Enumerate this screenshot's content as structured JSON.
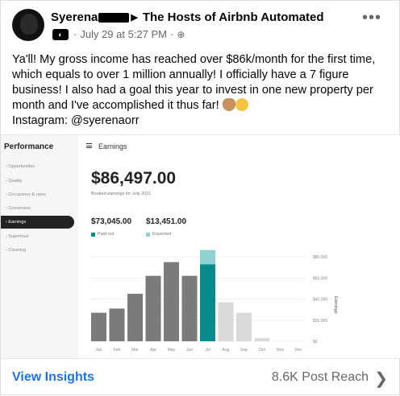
{
  "header": {
    "author_name": "Syerena",
    "group_name": "The Hosts of Airbnb Automated",
    "date": "July 29 at 5:27 PM",
    "separator": "·",
    "privacy_icon": "globe-icon",
    "more_icon": "more-options-icon"
  },
  "post": {
    "text": "Ya'll! My gross income has reached over $86k/month for the first time, which equals to over 1 million annually! I officially have a 7 figure business! I also had a goal this year to invest in one new property per month and I've accomplished it thus far!",
    "instagram": "Instagram: @syerenaorr"
  },
  "screenshot": {
    "sidebar_title": "Performance",
    "sidebar_items": [
      {
        "label": "Opportunities"
      },
      {
        "label": "Quality"
      },
      {
        "label": "Occupancy & rates"
      },
      {
        "label": "Conversion"
      },
      {
        "label": "Earnings"
      },
      {
        "label": "Superhost"
      },
      {
        "label": "Cleaning"
      }
    ],
    "active_item": "Earnings",
    "title": "Earnings",
    "total": "$86,497.00",
    "subtitle": "Booked earnings for July 2021",
    "paid_amount": "$73,045.00",
    "expected_amount": "$13,451.00",
    "paid_label": "Paid out",
    "expected_label": "Expected",
    "colors": {
      "paid": "#0b8a8e",
      "expected": "#8fd3d0",
      "past": "#7b7b7b",
      "future": "#d9d9d9",
      "active": "#222222"
    }
  },
  "chart_data": {
    "type": "bar",
    "categories": [
      "Jan",
      "Feb",
      "Mar",
      "Apr",
      "May",
      "Jun",
      "Jul",
      "Aug",
      "Sep",
      "Oct",
      "Nov",
      "Dec"
    ],
    "series": [
      {
        "name": "Paid out",
        "values": [
          27000,
          31000,
          45000,
          62000,
          75000,
          62000,
          73045,
          37000,
          27000,
          3000,
          0,
          0
        ]
      },
      {
        "name": "Expected",
        "values": [
          0,
          0,
          0,
          0,
          0,
          0,
          13451,
          0,
          0,
          0,
          0,
          0
        ]
      }
    ],
    "yticks": [
      "$80,000",
      "$60,000",
      "$40,000",
      "$20,000",
      "$0"
    ],
    "ytick_values": [
      80000,
      60000,
      40000,
      20000,
      0
    ],
    "ylabel": "Earnings",
    "ylim": [
      0,
      90000
    ],
    "current_index": 6,
    "stacked": true
  },
  "footer": {
    "insights_label": "View Insights",
    "reach_label": "8.6K Post Reach",
    "chevron_icon": "chevron-right-icon"
  }
}
